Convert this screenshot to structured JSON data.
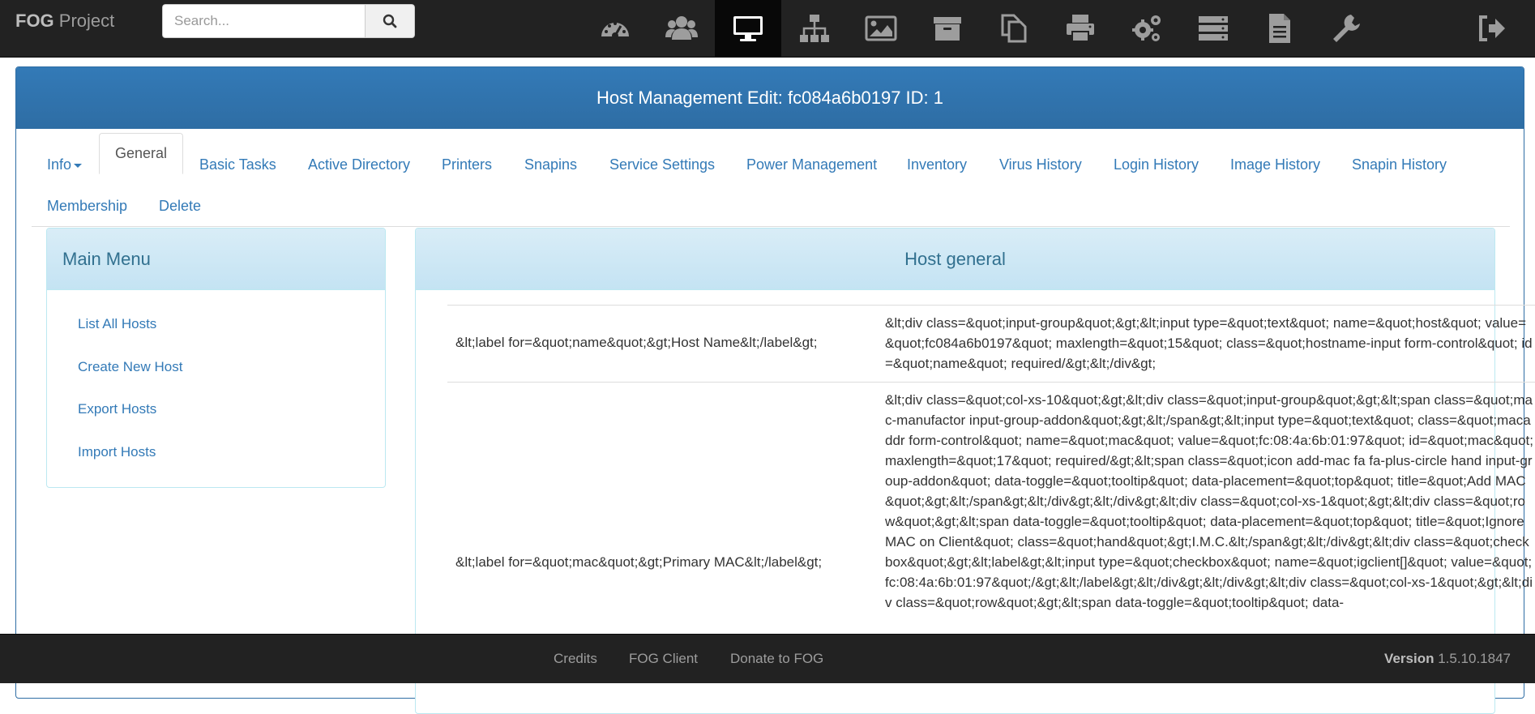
{
  "brand": {
    "bold": "FOG",
    "rest": " Project"
  },
  "search": {
    "placeholder": "Search..."
  },
  "nav_icons": [
    "dashboard-icon",
    "users-icon",
    "desktop-icon",
    "sitemap-icon",
    "image-icon",
    "archive-icon",
    "copy-icon",
    "printer-icon",
    "cogs-icon",
    "server-icon",
    "file-icon",
    "wrench-icon",
    "logout-icon"
  ],
  "panel": {
    "title": "Host Management Edit: fc084a6b0197 ID: 1"
  },
  "tabs": {
    "info": "Info",
    "general": "General",
    "basic_tasks": "Basic Tasks",
    "active_directory": "Active Directory",
    "printers": "Printers",
    "snapins": "Snapins",
    "service_settings": "Service Settings",
    "power_management": "Power Management",
    "inventory": "Inventory",
    "virus_history": "Virus History",
    "login_history": "Login History",
    "image_history": "Image History",
    "snapin_history": "Snapin History",
    "membership": "Membership",
    "delete": "Delete"
  },
  "main_menu": {
    "title": "Main Menu",
    "items": [
      "List All Hosts",
      "Create New Host",
      "Export Hosts",
      "Import Hosts"
    ]
  },
  "host_general": {
    "title": "Host general",
    "rows": [
      {
        "label": "&lt;label for=&quot;name&quot;&gt;Host Name&lt;/label&gt;",
        "value": "&lt;div class=&quot;input-group&quot;&gt;&lt;input type=&quot;text&quot; name=&quot;host&quot; value=&quot;fc084a6b0197&quot; maxlength=&quot;15&quot; class=&quot;hostname-input form-control&quot; id=&quot;name&quot; required/&gt;&lt;/div&gt;"
      },
      {
        "label": "&lt;label for=&quot;mac&quot;&gt;Primary MAC&lt;/label&gt;",
        "value": "&lt;div class=&quot;col-xs-10&quot;&gt;&lt;div class=&quot;input-group&quot;&gt;&lt;span class=&quot;mac-manufactor input-group-addon&quot;&gt;&lt;/span&gt;&lt;input type=&quot;text&quot; class=&quot;macaddr form-control&quot; name=&quot;mac&quot; value=&quot;fc:08:4a:6b:01:97&quot; id=&quot;mac&quot; maxlength=&quot;17&quot; required/&gt;&lt;span class=&quot;icon add-mac fa fa-plus-circle hand input-group-addon&quot; data-toggle=&quot;tooltip&quot; data-placement=&quot;top&quot; title=&quot;Add MAC&quot;&gt;&lt;/span&gt;&lt;/div&gt;&lt;/div&gt;&lt;div class=&quot;col-xs-1&quot;&gt;&lt;div class=&quot;row&quot;&gt;&lt;span data-toggle=&quot;tooltip&quot; data-placement=&quot;top&quot; title=&quot;Ignore MAC on Client&quot; class=&quot;hand&quot;&gt;I.M.C.&lt;/span&gt;&lt;/div&gt;&lt;div class=&quot;checkbox&quot;&gt;&lt;label&gt;&lt;input type=&quot;checkbox&quot; name=&quot;igclient[]&quot; value=&quot;fc:08:4a:6b:01:97&quot;/&gt;&lt;/label&gt;&lt;/div&gt;&lt;/div&gt;&lt;div class=&quot;col-xs-1&quot;&gt;&lt;div class=&quot;row&quot;&gt;&lt;span data-toggle=&quot;tooltip&quot; data-"
      }
    ]
  },
  "footer": {
    "links": [
      "Credits",
      "FOG Client",
      "Donate to FOG"
    ],
    "version_label": "Version",
    "version_number": " 1.5.10.1847"
  },
  "colors": {
    "navbar": "#222222",
    "primary": "#337ab7",
    "info_bg": "#d9edf7",
    "info_text": "#31708f"
  }
}
